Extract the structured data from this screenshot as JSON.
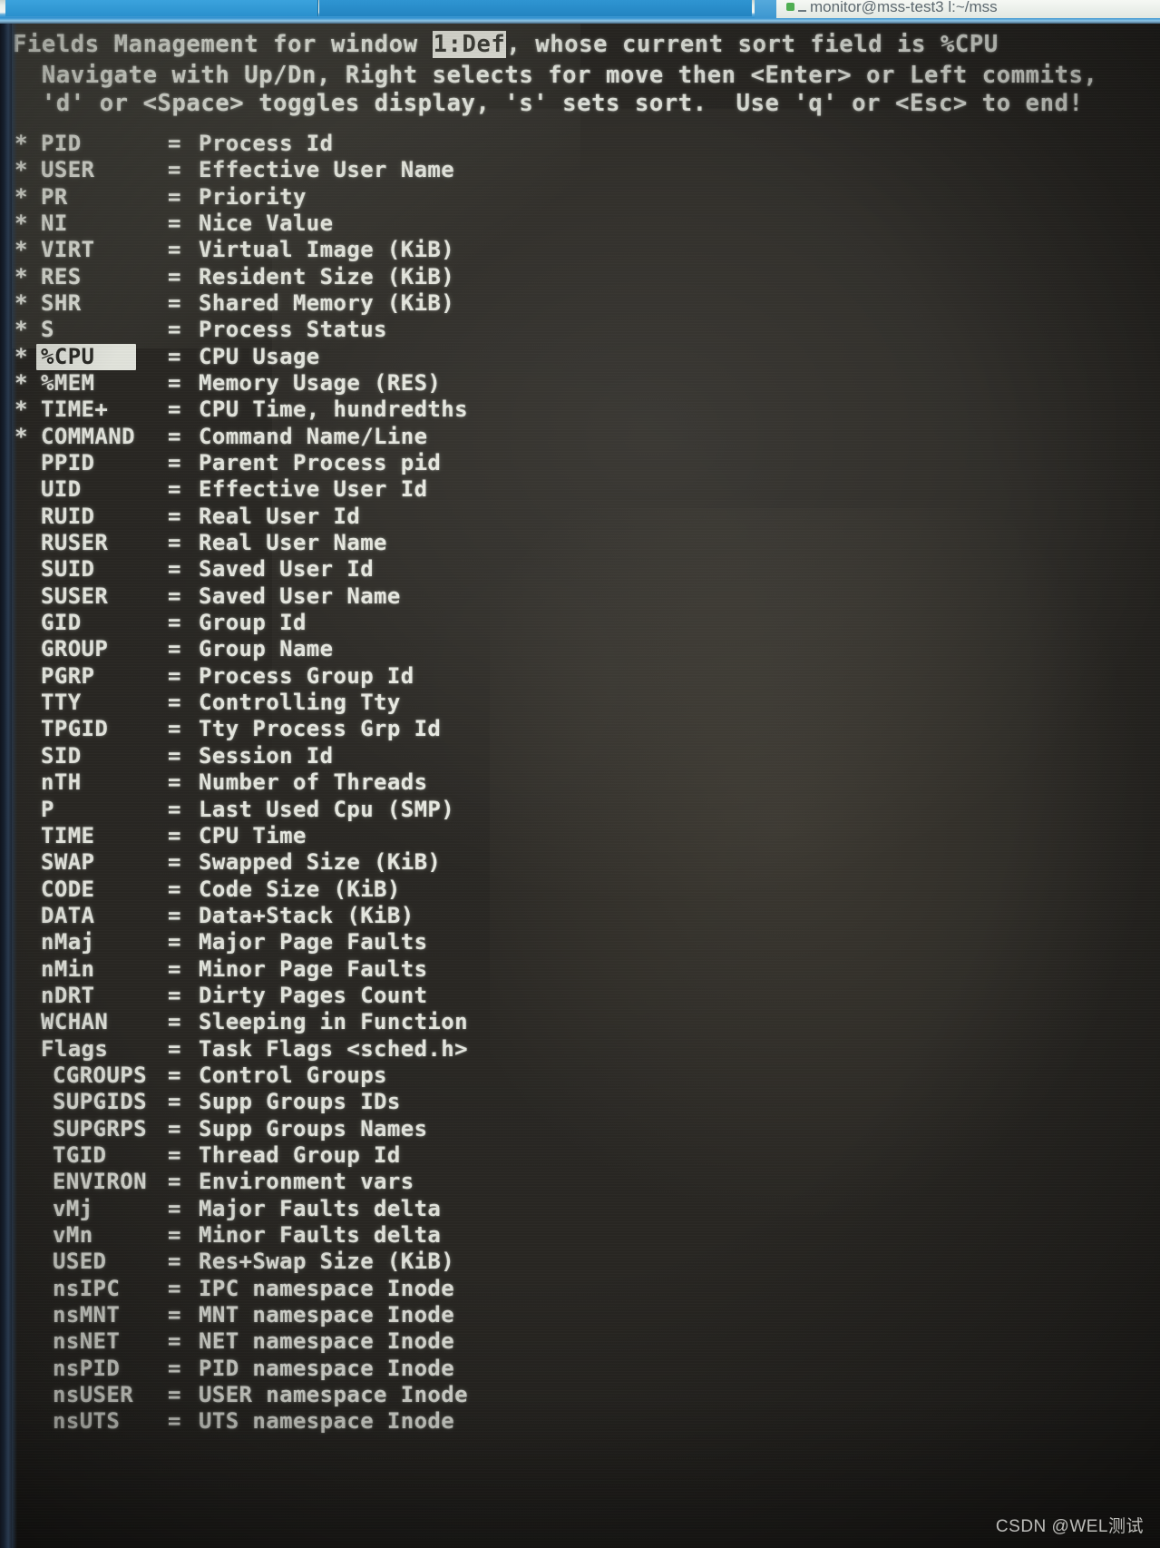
{
  "window_chrome": {
    "active_tab_title": "monitor@mss-test3 l:~/mss",
    "accent_color": "#2e8fcf"
  },
  "header": {
    "line1_prefix": "Fields Management for window ",
    "line1_window": "1:Def",
    "line1_suffix": ", whose current sort field is %CPU",
    "line2": "  Navigate with Up/Dn, Right selects for move then <Enter> or Left commits,",
    "line3": "  'd' or <Space> toggles display, 's' sets sort.  Use 'q' or <Esc> to end!"
  },
  "colors": {
    "terminal_bg": "#2b2925",
    "terminal_fg": "#eceee6",
    "highlight_bg": "#eef0e8",
    "highlight_fg": "#2d2d29"
  },
  "selected_field": "%CPU",
  "fields": [
    {
      "on": "*",
      "name": "PID",
      "eq": "=",
      "desc": "Process Id"
    },
    {
      "on": "*",
      "name": "USER",
      "eq": "=",
      "desc": "Effective User Name"
    },
    {
      "on": "*",
      "name": "PR",
      "eq": "=",
      "desc": "Priority"
    },
    {
      "on": "*",
      "name": "NI",
      "eq": "=",
      "desc": "Nice Value"
    },
    {
      "on": "*",
      "name": "VIRT",
      "eq": "=",
      "desc": "Virtual Image (KiB)"
    },
    {
      "on": "*",
      "name": "RES",
      "eq": "=",
      "desc": "Resident Size (KiB)"
    },
    {
      "on": "*",
      "name": "SHR",
      "eq": "=",
      "desc": "Shared Memory (KiB)"
    },
    {
      "on": "*",
      "name": "S",
      "eq": "=",
      "desc": "Process Status"
    },
    {
      "on": "*",
      "name": "%CPU",
      "eq": "=",
      "desc": "CPU Usage"
    },
    {
      "on": "*",
      "name": "%MEM",
      "eq": "=",
      "desc": "Memory Usage (RES)"
    },
    {
      "on": "*",
      "name": "TIME+",
      "eq": "=",
      "desc": "CPU Time, hundredths"
    },
    {
      "on": "*",
      "name": "COMMAND",
      "eq": "=",
      "desc": "Command Name/Line"
    },
    {
      "on": " ",
      "name": "PPID",
      "eq": "=",
      "desc": "Parent Process pid"
    },
    {
      "on": " ",
      "name": "UID",
      "eq": "=",
      "desc": "Effective User Id"
    },
    {
      "on": " ",
      "name": "RUID",
      "eq": "=",
      "desc": "Real User Id"
    },
    {
      "on": " ",
      "name": "RUSER",
      "eq": "=",
      "desc": "Real User Name"
    },
    {
      "on": " ",
      "name": "SUID",
      "eq": "=",
      "desc": "Saved User Id"
    },
    {
      "on": " ",
      "name": "SUSER",
      "eq": "=",
      "desc": "Saved User Name"
    },
    {
      "on": " ",
      "name": "GID",
      "eq": "=",
      "desc": "Group Id"
    },
    {
      "on": " ",
      "name": "GROUP",
      "eq": "=",
      "desc": "Group Name"
    },
    {
      "on": " ",
      "name": "PGRP",
      "eq": "=",
      "desc": "Process Group Id"
    },
    {
      "on": " ",
      "name": "TTY",
      "eq": "=",
      "desc": "Controlling Tty"
    },
    {
      "on": " ",
      "name": "TPGID",
      "eq": "=",
      "desc": "Tty Process Grp Id"
    },
    {
      "on": " ",
      "name": "SID",
      "eq": "=",
      "desc": "Session Id"
    },
    {
      "on": " ",
      "name": "nTH",
      "eq": "=",
      "desc": "Number of Threads"
    },
    {
      "on": " ",
      "name": "P",
      "eq": "=",
      "desc": "Last Used Cpu (SMP)"
    },
    {
      "on": " ",
      "name": "TIME",
      "eq": "=",
      "desc": "CPU Time"
    },
    {
      "on": " ",
      "name": "SWAP",
      "eq": "=",
      "desc": "Swapped Size (KiB)"
    },
    {
      "on": " ",
      "name": "CODE",
      "eq": "=",
      "desc": "Code Size (KiB)"
    },
    {
      "on": " ",
      "name": "DATA",
      "eq": "=",
      "desc": "Data+Stack (KiB)"
    },
    {
      "on": " ",
      "name": "nMaj",
      "eq": "=",
      "desc": "Major Page Faults"
    },
    {
      "on": " ",
      "name": "nMin",
      "eq": "=",
      "desc": "Minor Page Faults"
    },
    {
      "on": " ",
      "name": "nDRT",
      "eq": "=",
      "desc": "Dirty Pages Count"
    },
    {
      "on": " ",
      "name": "WCHAN",
      "eq": "=",
      "desc": "Sleeping in Function"
    },
    {
      "on": " ",
      "name": "Flags",
      "eq": "=",
      "desc": "Task Flags <sched.h>"
    },
    {
      "on": " ",
      "name": "CGROUPS",
      "eq": "=",
      "desc": "Control Groups",
      "wide": true
    },
    {
      "on": " ",
      "name": "SUPGIDS",
      "eq": "=",
      "desc": "Supp Groups IDs",
      "wide": true
    },
    {
      "on": " ",
      "name": "SUPGRPS",
      "eq": "=",
      "desc": "Supp Groups Names",
      "wide": true
    },
    {
      "on": " ",
      "name": "TGID",
      "eq": "=",
      "desc": "Thread Group Id",
      "wide": true
    },
    {
      "on": " ",
      "name": "ENVIRON",
      "eq": "=",
      "desc": "Environment vars",
      "wide": true
    },
    {
      "on": " ",
      "name": "vMj",
      "eq": "=",
      "desc": "Major Faults delta",
      "wide": true
    },
    {
      "on": " ",
      "name": "vMn",
      "eq": "=",
      "desc": "Minor Faults delta",
      "wide": true
    },
    {
      "on": " ",
      "name": "USED",
      "eq": "=",
      "desc": "Res+Swap Size (KiB)",
      "wide": true
    },
    {
      "on": " ",
      "name": "nsIPC",
      "eq": "=",
      "desc": "IPC namespace Inode",
      "wide": true
    },
    {
      "on": " ",
      "name": "nsMNT",
      "eq": "=",
      "desc": "MNT namespace Inode",
      "wide": true
    },
    {
      "on": " ",
      "name": "nsNET",
      "eq": "=",
      "desc": "NET namespace Inode",
      "wide": true
    },
    {
      "on": " ",
      "name": "nsPID",
      "eq": "=",
      "desc": "PID namespace Inode",
      "wide": true
    },
    {
      "on": " ",
      "name": "nsUSER",
      "eq": "=",
      "desc": "USER namespace Inode",
      "wide": true
    },
    {
      "on": " ",
      "name": "nsUTS",
      "eq": "=",
      "desc": "UTS namespace Inode",
      "wide": true
    }
  ],
  "watermark": "CSDN @WEL测试"
}
